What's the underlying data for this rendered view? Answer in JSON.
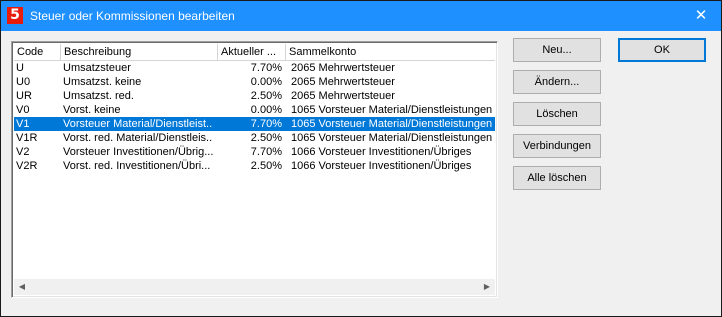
{
  "window": {
    "title": "Steuer oder Kommissionen bearbeiten",
    "icon_glyph": "5",
    "close_glyph": "✕"
  },
  "table": {
    "headers": {
      "code": "Code",
      "desc": "Beschreibung",
      "rate": "Aktueller ...",
      "account": "Sammelkonto"
    },
    "rows": [
      {
        "code": "U",
        "desc": "Umsatzsteuer",
        "rate": "7.70%",
        "account": "2065 Mehrwertsteuer",
        "selected": false
      },
      {
        "code": "U0",
        "desc": "Umsatzst. keine",
        "rate": "0.00%",
        "account": "2065 Mehrwertsteuer",
        "selected": false
      },
      {
        "code": "UR",
        "desc": "Umsatzst. red.",
        "rate": "2.50%",
        "account": "2065 Mehrwertsteuer",
        "selected": false
      },
      {
        "code": "V0",
        "desc": "Vorst. keine",
        "rate": "0.00%",
        "account": "1065 Vorsteuer Material/Dienstleistungen",
        "selected": false
      },
      {
        "code": "V1",
        "desc": "Vorsteuer Material/Dienstleist...",
        "rate": "7.70%",
        "account": "1065 Vorsteuer Material/Dienstleistungen",
        "selected": true
      },
      {
        "code": "V1R",
        "desc": "Vorst. red. Material/Dienstleis...",
        "rate": "2.50%",
        "account": "1065 Vorsteuer Material/Dienstleistungen",
        "selected": false
      },
      {
        "code": "V2",
        "desc": "Vorsteuer Investitionen/Übrig...",
        "rate": "7.70%",
        "account": "1066 Vorsteuer Investitionen/Übriges",
        "selected": false
      },
      {
        "code": "V2R",
        "desc": "Vorst. red. Investitionen/Übri...",
        "rate": "2.50%",
        "account": "1066 Vorsteuer Investitionen/Übriges",
        "selected": false
      }
    ],
    "scroll_left_glyph": "◀",
    "scroll_right_glyph": "▶"
  },
  "buttons": {
    "new": "Neu...",
    "change": "Ändern...",
    "delete": "Löschen",
    "links": "Verbindungen",
    "delete_all": "Alle löschen",
    "ok": "OK"
  },
  "colors": {
    "title_bar": "#1e90ff",
    "selection": "#0078d7",
    "app_icon": "#e81c0c"
  }
}
